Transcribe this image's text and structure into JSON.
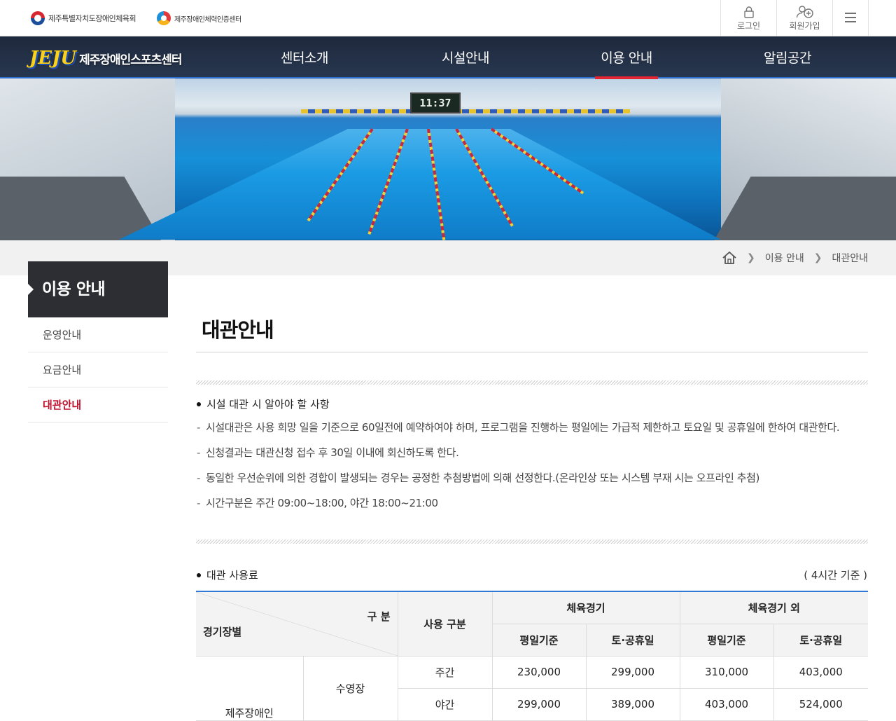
{
  "header": {
    "org1": "제주특별자치도장애인체육회",
    "org2": "제주장애인체력인증센터",
    "login_label": "로그인",
    "join_label": "회원가입"
  },
  "brand": {
    "mark": "JEJU",
    "name": "제주장애인스포츠센터"
  },
  "nav": {
    "items": [
      {
        "label": "센터소개"
      },
      {
        "label": "시설안내"
      },
      {
        "label": "이용 안내"
      },
      {
        "label": "알림공간"
      }
    ]
  },
  "hero": {
    "clock": "11:37"
  },
  "breadcrumb": {
    "items": [
      "이용 안내",
      "대관안내"
    ]
  },
  "sidebar": {
    "title": "이용 안내",
    "items": [
      {
        "label": "운영안내"
      },
      {
        "label": "요금안내"
      },
      {
        "label": "대관안내"
      }
    ]
  },
  "main": {
    "title": "대관안내",
    "section1": {
      "heading": "시설 대관 시 알아야 할 사항",
      "notes": [
        "시설대관은 사용 희망 일을 기준으로 60일전에 예약하여야 하며, 프로그램을 진행하는 평일에는 가급적 제한하고 토요일 및 공휴일에 한하여 대관한다.",
        "신청결과는 대관신청 접수 후 30일 이내에 회신하도록 한다.",
        "동일한 우선순위에 의한 경합이 발생되는 경우는 공정한 추첨방법에 의해 선정한다.(온라인상 또는 시스템 부재 시는 오프라인 추첨)",
        "시간구분은 주간 09:00~18:00, 야간 18:00~21:00"
      ]
    },
    "section2": {
      "heading": "대관 사용료",
      "note": "( 4시간 기준 )"
    },
    "fee_table": {
      "corner_top": "구 분",
      "corner_bottom": "경기장별",
      "col_use": "사용 구분",
      "group1": "체육경기",
      "group2": "체육경기 외",
      "sub_weekday": "평일기준",
      "sub_holiday": "토·공휴일",
      "facility_group": "제주장애인",
      "facility": "수영장",
      "rows": [
        {
          "period": "주간",
          "v1": "230,000",
          "v2": "299,000",
          "v3": "310,000",
          "v4": "403,000"
        },
        {
          "period": "야간",
          "v1": "299,000",
          "v2": "389,000",
          "v3": "403,000",
          "v4": "524,000"
        }
      ]
    }
  },
  "colors": {
    "accent": "#2f78d3",
    "active": "#c2102c",
    "sidebar_title_bg": "#2d2e33",
    "nav_underline": "#e32530"
  }
}
